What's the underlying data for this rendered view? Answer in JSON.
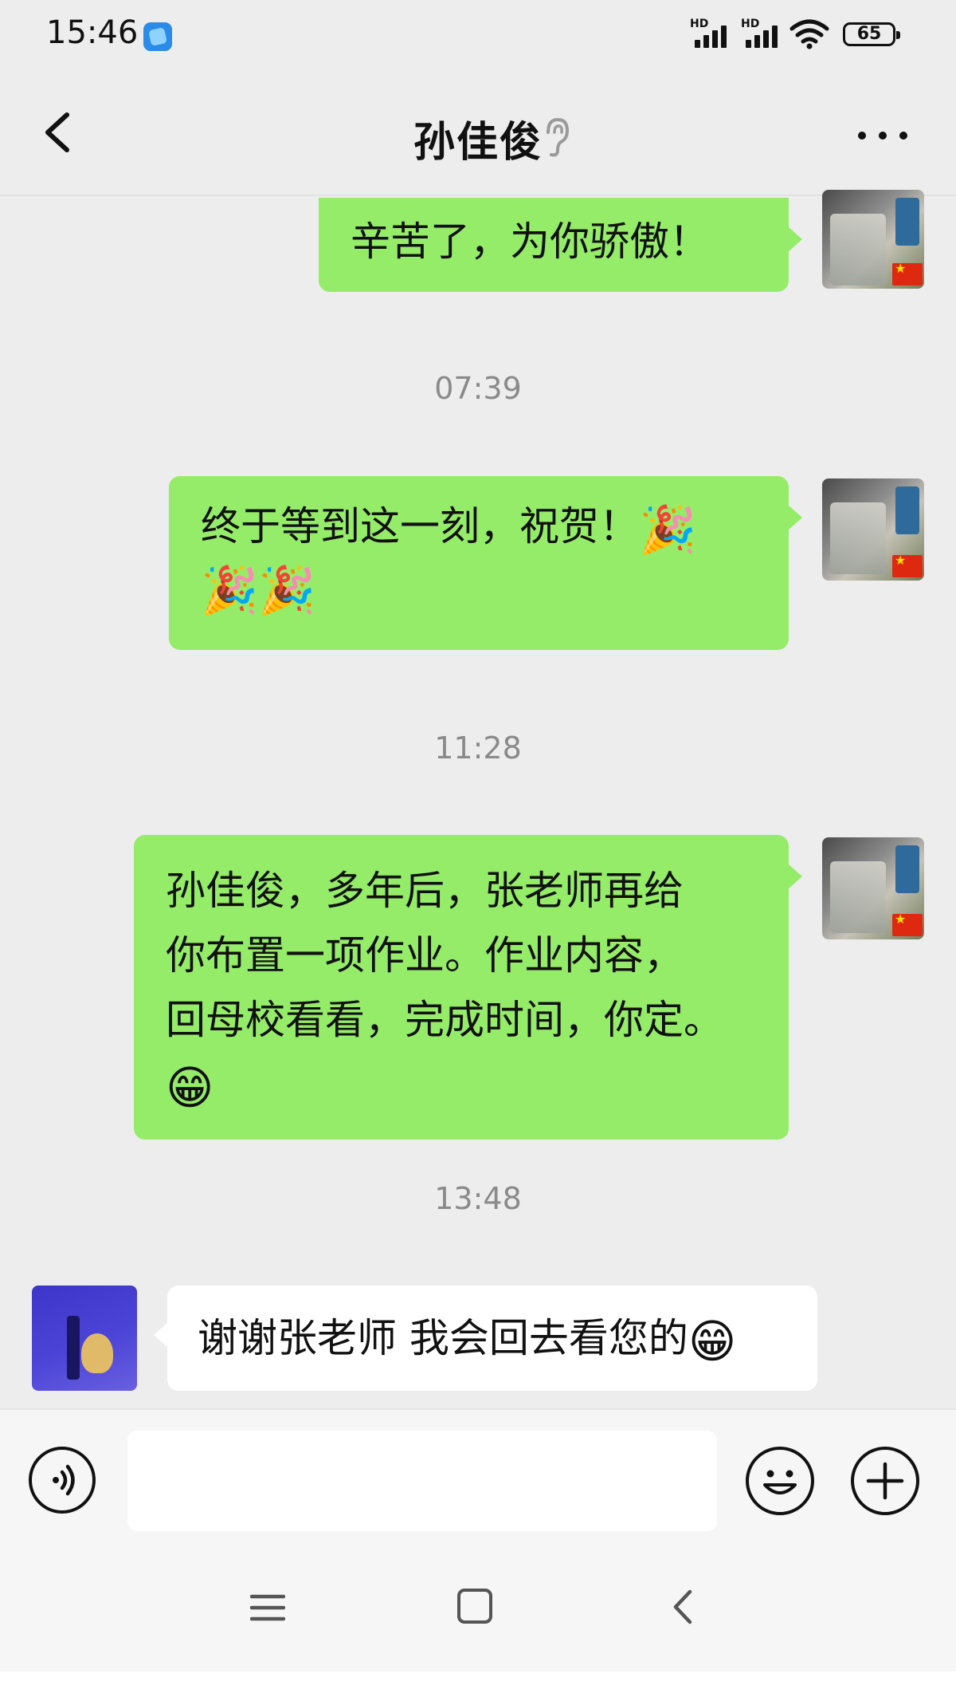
{
  "status_bar": {
    "time": "15:46",
    "signal_label_1": "HD",
    "signal_label_2": "HD",
    "battery": "65",
    "icons": [
      "app-notification-icon",
      "signal-icon",
      "signal-icon",
      "wifi-icon",
      "battery-icon"
    ]
  },
  "header": {
    "title": "孙佳俊",
    "icons": [
      "back-icon",
      "ear-icon",
      "more-icon"
    ]
  },
  "messages": [
    {
      "side": "sent",
      "text": "辛苦了，为你骄傲！"
    },
    {
      "side": "timestamp",
      "text": "07:39"
    },
    {
      "side": "sent",
      "text_line1": "终于等到这一刻，祝贺！",
      "emoji_a": "🎉",
      "emoji_b": "🎉",
      "emoji_c": "🎉"
    },
    {
      "side": "timestamp",
      "text": "11:28"
    },
    {
      "side": "sent",
      "line1": "孙佳俊，多年后，张老师再给",
      "line2": "你布置一项作业。作业内容，",
      "line3": "回母校看看，完成时间，你定。",
      "emoji": "😁"
    },
    {
      "side": "timestamp",
      "text": "13:48"
    },
    {
      "side": "received",
      "text": "谢谢张老师 我会回去看您的",
      "emoji": "😁"
    }
  ],
  "input_bar": {
    "value": "",
    "icons": [
      "voice-icon",
      "emoji-icon",
      "plus-icon"
    ]
  },
  "system_nav": {
    "icons": [
      "menu-icon",
      "home-icon",
      "back-icon"
    ]
  },
  "colors": {
    "sent_bubble": "#95ec69",
    "received_bubble": "#ffffff",
    "background": "#ededed",
    "timestamp": "#8a8a8a"
  }
}
